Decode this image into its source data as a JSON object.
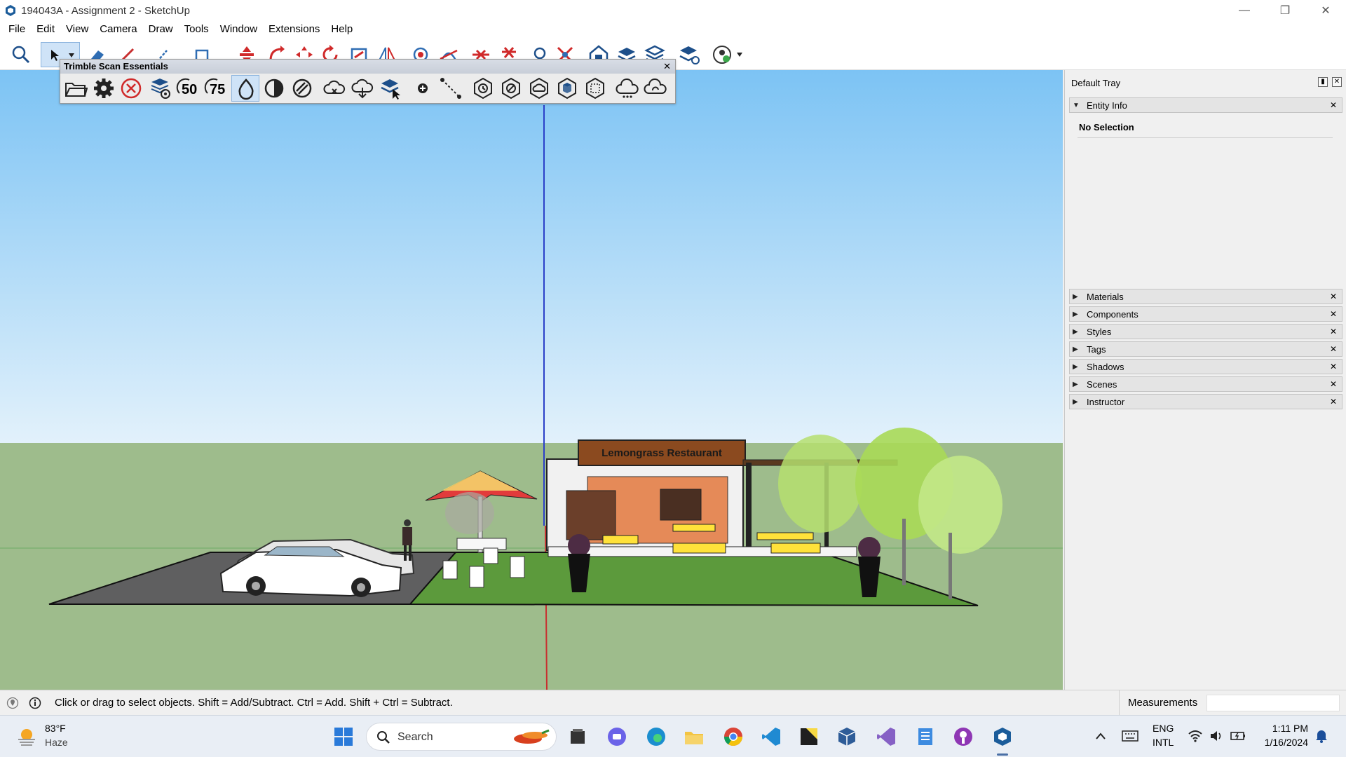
{
  "window": {
    "title": "194043A - Assignment 2 - SketchUp",
    "controls": [
      "minimize",
      "restore",
      "close"
    ]
  },
  "menu": [
    "File",
    "Edit",
    "View",
    "Camera",
    "Draw",
    "Tools",
    "Window",
    "Extensions",
    "Help"
  ],
  "toolbar": {
    "icons": [
      "search-icon",
      "select-arrow-icon",
      "eraser-icon",
      "pencil-icon",
      "line-icon",
      "rectangle-icon",
      "move-icon",
      "rotate-icon",
      "scale-icon",
      "follow-me-icon",
      "push-pull-icon",
      "flip-icon",
      "component-icon",
      "section-icon",
      "sandbox-icon",
      "terrain-icon",
      "circle-icon",
      "split-icon",
      "warehouse-icon",
      "layers-icon",
      "layers2-icon",
      "layers-settings-icon",
      "account-icon"
    ]
  },
  "scan_toolbar": {
    "title": "Trimble Scan Essentials",
    "icons": [
      "open-folder-icon",
      "settings-gear-icon",
      "cancel-circle-icon",
      "scan-view-icon",
      "scan-50-icon",
      "scan-75-icon",
      "drop-icon",
      "contrast-icon",
      "stripes-icon",
      "cloud-x-icon",
      "cloud-down-icon",
      "stack-cursor-icon",
      "point-icon",
      "dotted-line-icon",
      "hex-clock-icon",
      "hex-slash-icon",
      "hex-cloud-icon",
      "hex-cube-icon",
      "hex-box-icon",
      "cloud-dots-icon",
      "cloud-sync-icon"
    ],
    "labels": {
      "icon_50": "50",
      "icon_75": "75"
    }
  },
  "tray": {
    "title": "Default Tray",
    "entity_info": {
      "label": "Entity Info",
      "status": "No Selection"
    },
    "panels": [
      "Materials",
      "Components",
      "Styles",
      "Tags",
      "Shadows",
      "Scenes",
      "Instructor"
    ]
  },
  "scene": {
    "sign_text": "Lemongrass Restaurant"
  },
  "statusbar": {
    "hint": "Click or drag to select objects. Shift = Add/Subtract. Ctrl = Add. Shift + Ctrl = Subtract.",
    "measurements_label": "Measurements",
    "measurements_value": ""
  },
  "taskbar": {
    "weather_temp": "83°F",
    "weather_desc": "Haze",
    "search_placeholder": "Search",
    "apps": [
      "start-icon",
      "search-icon",
      "file-explorer-bw-icon",
      "chat-icon",
      "edge-icon",
      "folder-icon",
      "chrome-icon",
      "vscode-icon",
      "sticky-notes-icon",
      "virtualbox-icon",
      "visual-studio-icon",
      "notepad-icon",
      "podcast-icon",
      "sketchup-icon"
    ],
    "lang_top": "ENG",
    "lang_bottom": "INTL",
    "time": "1:11 PM",
    "date": "1/16/2024"
  },
  "colors": {
    "sky_top": "#7cc3f4",
    "sky_bottom": "#dff0fb",
    "ground": "#9ebc8c",
    "axis_blue": "#2b40c8",
    "axis_red": "#c83030",
    "axis_green": "#2f9a2f"
  }
}
